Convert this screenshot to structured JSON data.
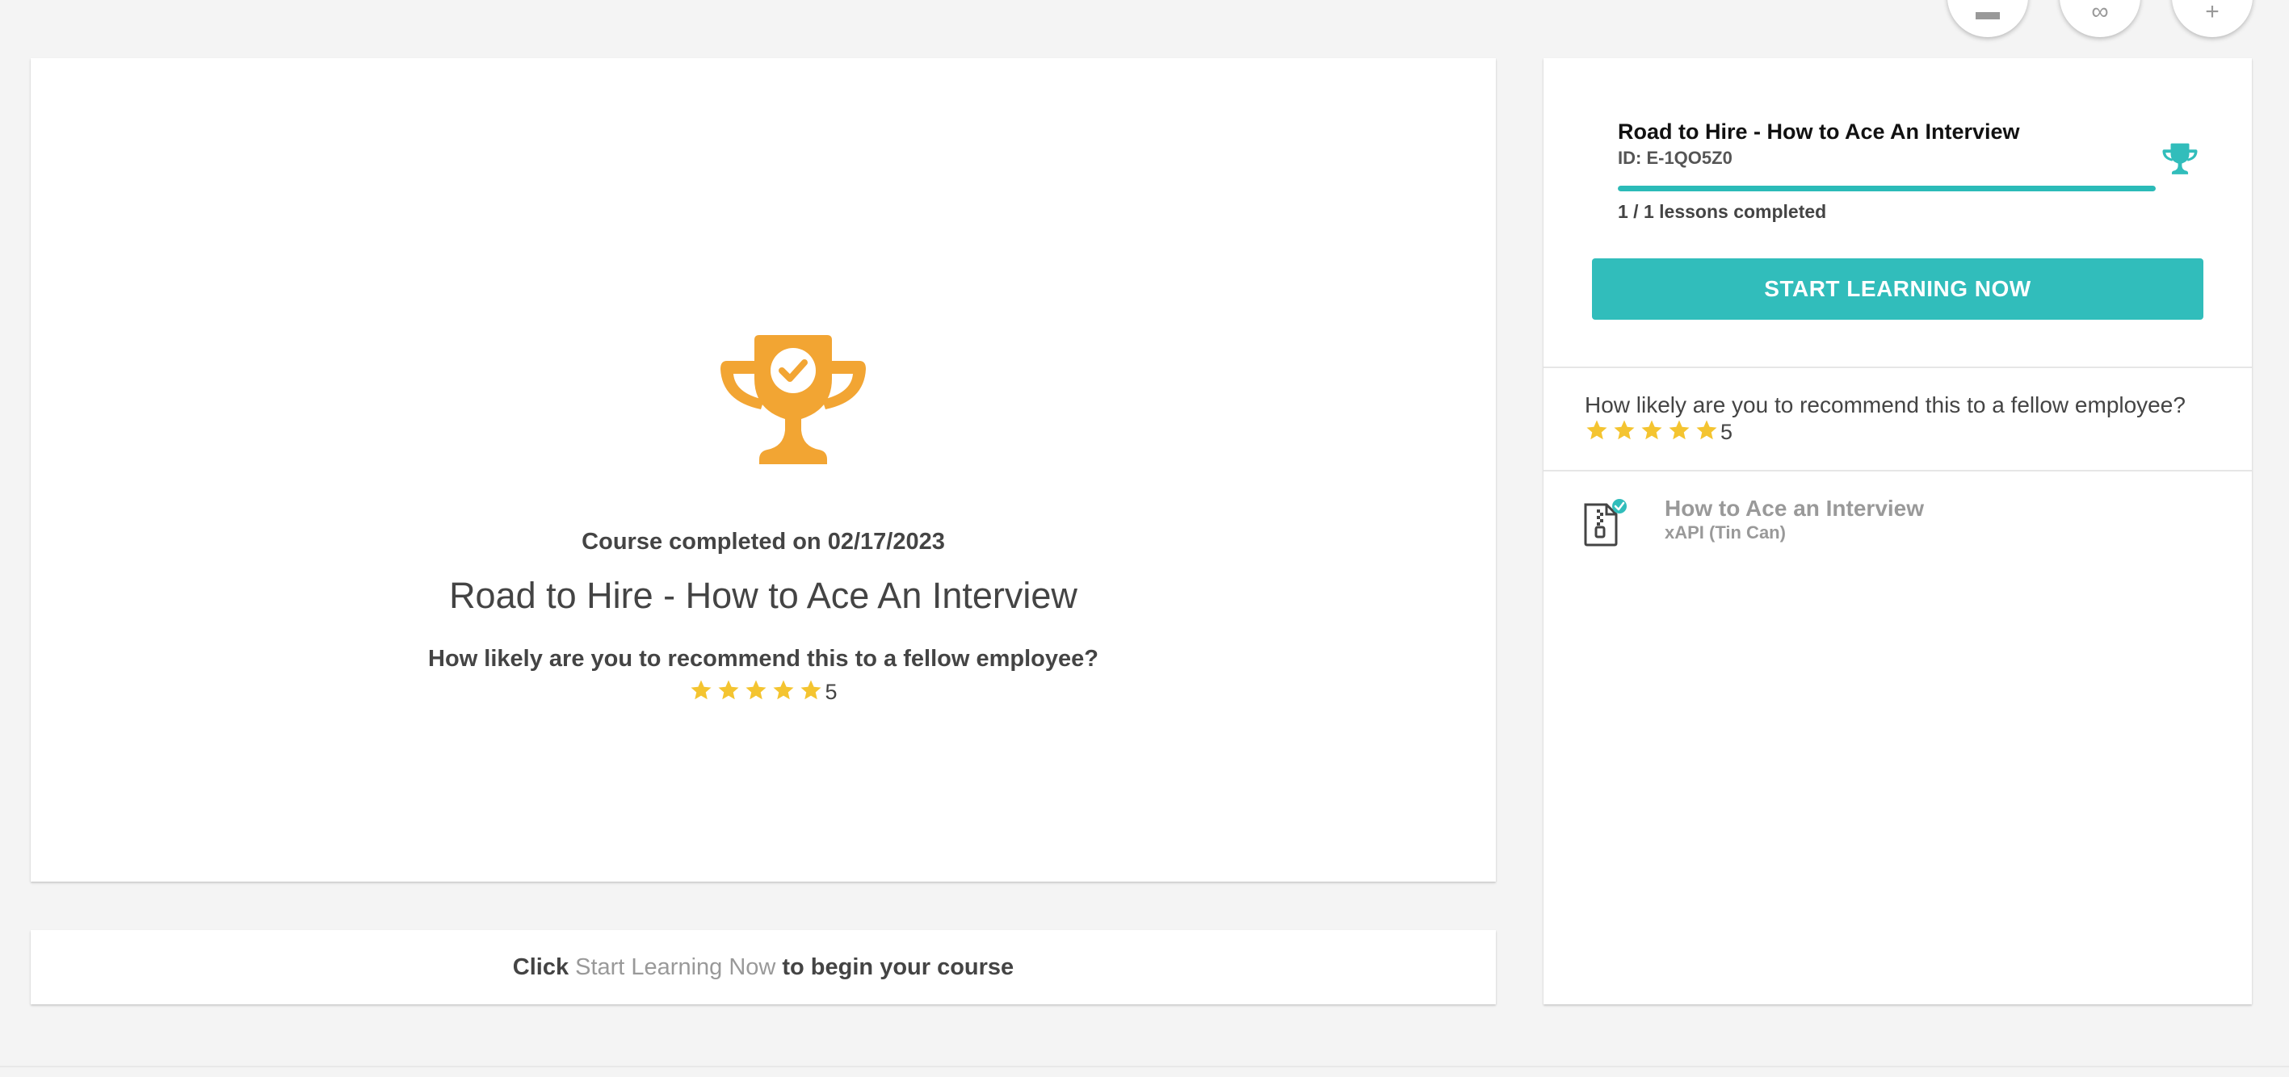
{
  "top_actions": [
    {
      "name": "layout-icon",
      "glyph": "▬"
    },
    {
      "name": "link-icon",
      "glyph": "∞"
    },
    {
      "name": "add-icon",
      "glyph": "+"
    }
  ],
  "main": {
    "completed_text": "Course completed on 02/17/2023",
    "course_title": "Road to Hire - How to Ace An Interview",
    "question": "How likely are you to recommend this to a fellow employee?",
    "rating": "5",
    "rating_value": 5,
    "star_color": "#f4c430",
    "trophy_color": "#f2a533"
  },
  "bottom": {
    "prefix": "Click",
    "link": "Start Learning Now",
    "suffix": "to begin your course"
  },
  "side": {
    "title": "Road to Hire - How to Ace An Interview",
    "id_text": "ID: E-1QO5Z0",
    "progress_fraction": 1.0,
    "lessons_text": "1 / 1 lessons completed",
    "start_button": "START LEARNING NOW",
    "question": "How likely are you to recommend this to a fellow employee?",
    "rating": "5",
    "accent_color": "#31bdbb",
    "lesson": {
      "title": "How to Ace an Interview",
      "type": "xAPI (Tin Can)"
    }
  }
}
